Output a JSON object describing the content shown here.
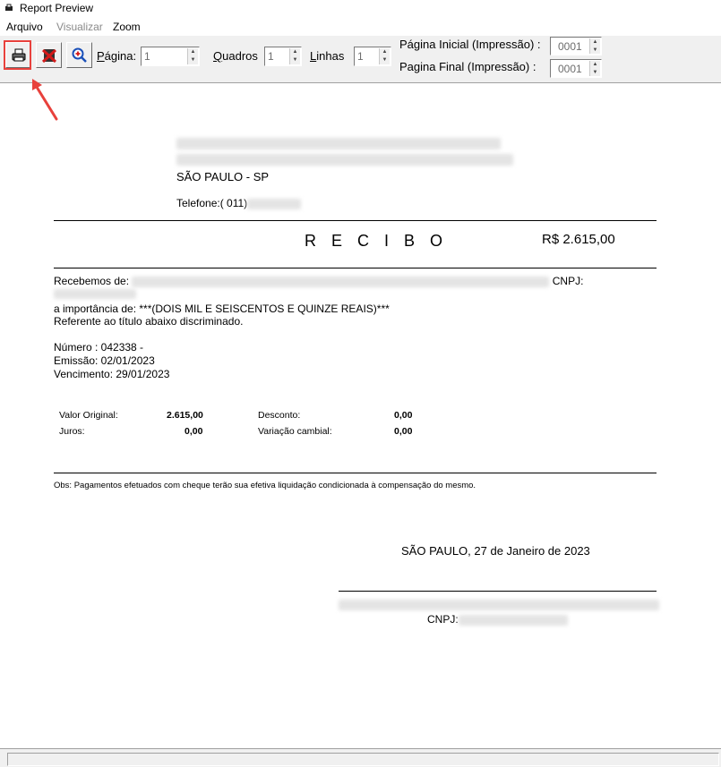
{
  "window": {
    "title": "Report Preview"
  },
  "menu": {
    "arquivo": "Arquivo",
    "visualizar": "Visualizar",
    "zoom": "Zoom"
  },
  "toolbar": {
    "pagina_label_u": "P",
    "pagina_label_rest": "ágina:",
    "pagina_value": "1",
    "quadros_label_u": "Q",
    "quadros_label_rest": "uadros",
    "quadros_value": "1",
    "linhas_label_u": "L",
    "linhas_label_rest": "inhas",
    "linhas_value": "1",
    "pagina_inicial_label": "Página Inicial (Impressão) :",
    "pagina_inicial_value": "0001",
    "pagina_final_label": "Pagina Final (Impressão) :",
    "pagina_final_value": "0001"
  },
  "report": {
    "city_state": "SÃO PAULO - SP",
    "telefone": "Telefone:( 011)",
    "title": "R E C I B O",
    "amount": "R$ 2.615,00",
    "recebemos": "Recebemos de:",
    "cnpj_label": "CNPJ:",
    "importancia": "a importância de: ***(DOIS MIL E SEISCENTOS E QUINZE REAIS)***",
    "referente": "Referente ao título abaixo discriminado.",
    "numero": "Número : 042338 -",
    "emissao": "Emissão: 02/01/2023",
    "vencimento": "Vencimento: 29/01/2023",
    "valor_original_label": "Valor Original:",
    "valor_original": "2.615,00",
    "juros_label": "Juros:",
    "juros": "0,00",
    "desconto_label": "Desconto:",
    "desconto": "0,00",
    "variacao_label": "Variação cambial:",
    "variacao": "0,00",
    "obs": "Obs: Pagamentos efetuados com cheque terão sua efetiva liquidação condicionada à compensação do mesmo.",
    "date_line": "SÃO PAULO, 27 de Janeiro de 2023",
    "sign_cnpj": "CNPJ:"
  }
}
